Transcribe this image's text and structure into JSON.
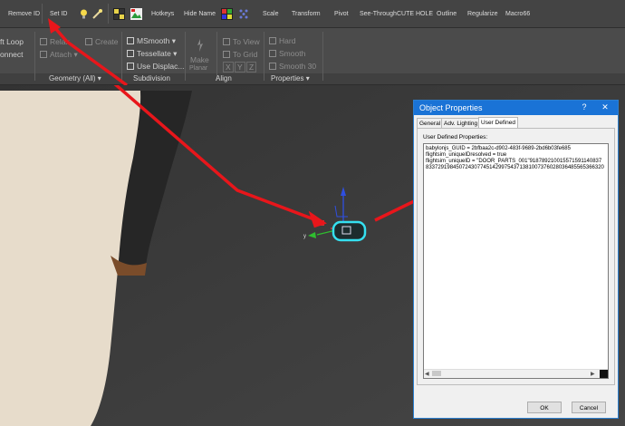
{
  "toolbar": {
    "remove_id": "Remove ID",
    "set_id": "Set ID",
    "hotkeys": "Hotkeys",
    "hide_name": "Hide Name",
    "scale": "Scale",
    "transform": "Transform",
    "pivot": "Pivot",
    "see_through": "See-Through",
    "cute_hole": "CUTE HOLE",
    "outline": "Outline",
    "regularize": "Regularize",
    "macro66": "Macro66"
  },
  "ribbon": {
    "loop": "ft Loop",
    "connect": "onnect",
    "relax": "Relax",
    "attach": "Attach",
    "create": "Create",
    "msmooth": "MSmooth",
    "tessellate": "Tessellate",
    "use_displace": "Use Displac...",
    "make_planar": "Make",
    "make_planar_2": "Planar",
    "to_view": "To View",
    "to_grid": "To Grid",
    "x": "X",
    "y": "Y",
    "z": "Z",
    "hard": "Hard",
    "smooth": "Smooth",
    "smooth30": "Smooth 30",
    "groups": {
      "geometry": "Geometry (All)",
      "subdivision": "Subdivision",
      "align": "Align",
      "properties": "Properties"
    }
  },
  "dialog": {
    "title": "Object Properties",
    "help": "?",
    "close": "✕",
    "tabs": [
      "General",
      "Adv. Lighting",
      "User Defined"
    ],
    "user_defined_label": "User Defined Properties:",
    "lines": [
      "babylonjs_GUID = 2bfbaa2c-d902-483f-9689-2bd6b03fe685",
      "flightsim_uniqueIDresolved = true",
      "flightsim_uniqueID = \"DOOR_PARTS_001\"918789210015571591140837",
      "83372919845072430774514299754371381007376028036485565366320"
    ],
    "ok": "OK",
    "cancel": "Cancel"
  },
  "colors": {
    "annotation_arrow": "#e8161b",
    "selection_highlight": "#35e0f0",
    "dialog_title": "#1a73d6"
  }
}
